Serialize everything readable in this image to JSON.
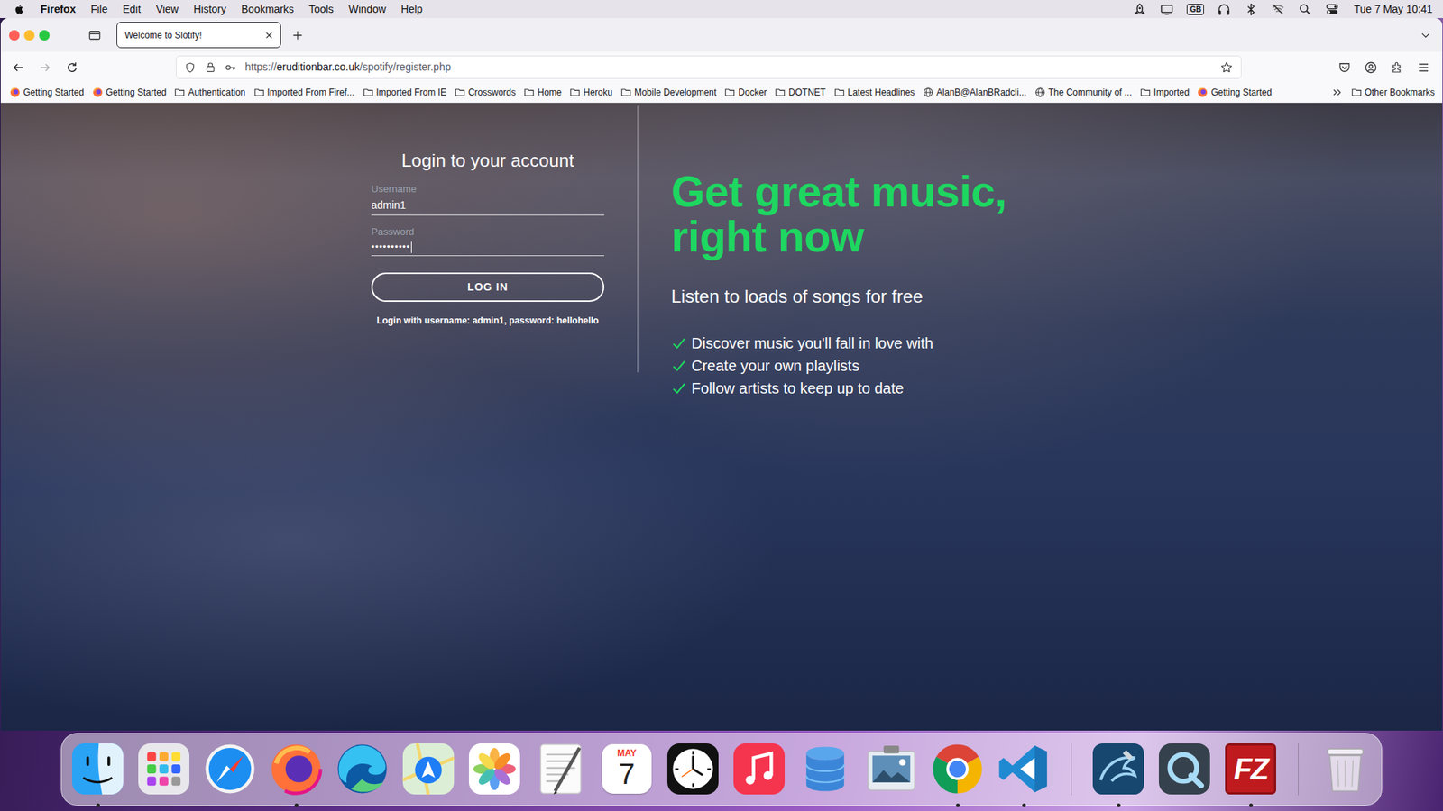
{
  "menubar": {
    "app": "Firefox",
    "menus": [
      "File",
      "Edit",
      "View",
      "History",
      "Bookmarks",
      "Tools",
      "Window",
      "Help"
    ],
    "status": [
      {
        "kind": "rocket"
      },
      {
        "kind": "display"
      },
      {
        "kind": "input",
        "label": "GB"
      },
      {
        "kind": "headphones"
      },
      {
        "kind": "bluetooth"
      },
      {
        "kind": "wifi-off"
      },
      {
        "kind": "search"
      },
      {
        "kind": "control-center"
      }
    ],
    "clock": "Tue 7 May 10:41"
  },
  "tabs": [
    {
      "label": "Welcome to Slotify!",
      "selected": true
    }
  ],
  "navigation": {
    "back": {
      "disabled": false
    },
    "forward": {
      "disabled": true
    }
  },
  "address_bar": {
    "scheme": "https://",
    "host": "eruditionbar.co.uk",
    "path": "/spotify/register.php"
  },
  "bookmarks": {
    "items": [
      {
        "label": "Getting Started",
        "kind": "firefox"
      },
      {
        "label": "Getting Started",
        "kind": "firefox"
      },
      {
        "label": "Authentication",
        "kind": "folder"
      },
      {
        "label": "Imported From Firef...",
        "kind": "folder"
      },
      {
        "label": "Imported From IE",
        "kind": "folder"
      },
      {
        "label": "Crosswords",
        "kind": "folder"
      },
      {
        "label": "Home",
        "kind": "folder"
      },
      {
        "label": "Heroku",
        "kind": "folder"
      },
      {
        "label": "Mobile Development",
        "kind": "folder"
      },
      {
        "label": "Docker",
        "kind": "folder"
      },
      {
        "label": "DOTNET",
        "kind": "folder"
      },
      {
        "label": "Latest Headlines",
        "kind": "folder"
      },
      {
        "label": "AlanB@AlanBRadcli...",
        "kind": "globe"
      },
      {
        "label": "The Community of ...",
        "kind": "globe"
      },
      {
        "label": "Imported",
        "kind": "folder"
      },
      {
        "label": "Getting Started",
        "kind": "firefox"
      }
    ],
    "other": "Other Bookmarks"
  },
  "login": {
    "title": "Login to your account",
    "fields": [
      {
        "label": "Username",
        "value": "admin1",
        "kind": "text",
        "focused": false
      },
      {
        "label": "Password",
        "value": "••••••••••",
        "kind": "password",
        "focused": true
      }
    ],
    "button": "LOG IN",
    "hint": "Login with username: admin1, password: hellohello"
  },
  "hero": {
    "heading": "Get great music, right now",
    "subheading": "Listen to loads of songs for free",
    "features": [
      "Discover music you'll fall in love with",
      "Create your own playlists",
      "Follow artists to keep up to date"
    ]
  },
  "dock": {
    "items": [
      {
        "kind": "finder",
        "running": true
      },
      {
        "kind": "launchpad",
        "running": false
      },
      {
        "kind": "safari",
        "running": false
      },
      {
        "kind": "firefox",
        "running": true
      },
      {
        "kind": "edge",
        "running": false
      },
      {
        "kind": "maps",
        "running": false
      },
      {
        "kind": "photos",
        "running": false
      },
      {
        "kind": "textedit",
        "running": false
      },
      {
        "kind": "calendar",
        "month": "MAY",
        "day": "7",
        "running": false
      },
      {
        "kind": "clock",
        "running": false
      },
      {
        "kind": "music",
        "running": false
      },
      {
        "kind": "database",
        "running": false
      },
      {
        "kind": "preview",
        "running": false
      },
      {
        "kind": "chrome",
        "running": true
      },
      {
        "kind": "vscode",
        "running": true
      },
      {
        "kind": "separator"
      },
      {
        "kind": "mysql",
        "running": true
      },
      {
        "kind": "quicktime",
        "running": false
      },
      {
        "kind": "filezilla",
        "glyph": "FZ",
        "running": true
      },
      {
        "kind": "separator"
      },
      {
        "kind": "trash",
        "running": false
      }
    ]
  }
}
